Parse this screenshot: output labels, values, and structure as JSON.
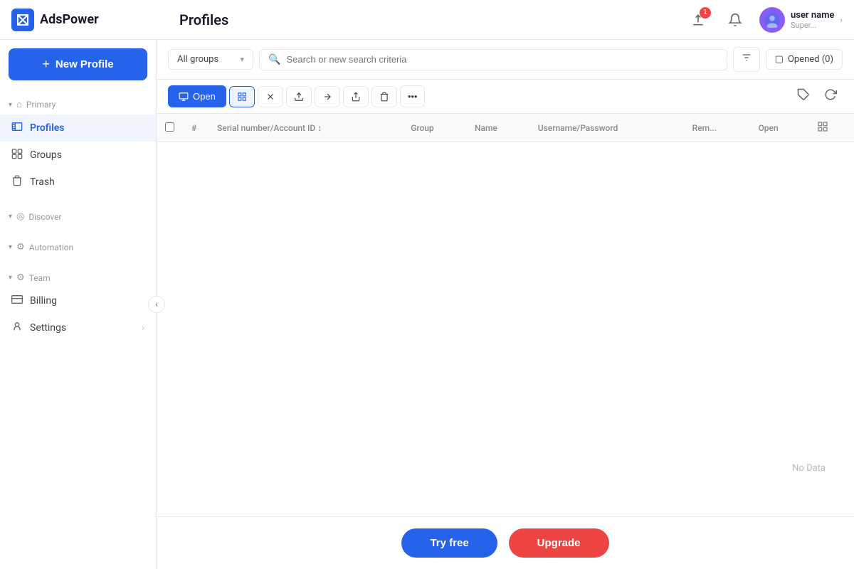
{
  "header": {
    "logo_text": "AdsPower",
    "logo_icon": "X",
    "title": "Profiles",
    "upload_badge": "1",
    "user_name": "user name",
    "user_role": "Super...",
    "chevron": "›"
  },
  "sidebar": {
    "new_profile_label": "New Profile",
    "plus_icon": "+",
    "sections": [
      {
        "name": "primary",
        "label": "Primary",
        "arrow": "▾",
        "items": [
          {
            "id": "profiles",
            "label": "Profiles",
            "icon": "📁",
            "active": true
          },
          {
            "id": "groups",
            "label": "Groups",
            "icon": "🗂"
          },
          {
            "id": "trash",
            "label": "Trash",
            "icon": "🗑"
          }
        ]
      },
      {
        "name": "discover",
        "label": "Discover",
        "arrow": "▾",
        "items": []
      },
      {
        "name": "automation",
        "label": "Automation",
        "arrow": "▾",
        "items": []
      },
      {
        "name": "team",
        "label": "Team",
        "arrow": "▾",
        "items": [
          {
            "id": "billing",
            "label": "Billing",
            "icon": "💳"
          },
          {
            "id": "settings",
            "label": "Settings",
            "icon": "👤",
            "chevron": "›"
          }
        ]
      }
    ],
    "toggle_icon": "‹"
  },
  "toolbar": {
    "groups_label": "All groups",
    "search_placeholder": "Search or new search criteria",
    "filter_icon": "⚙",
    "opened_icon": "▢",
    "opened_label": "Opened (0)"
  },
  "actions": {
    "open_label": "Open",
    "open_icon": "▢",
    "batch_icon": "⊞",
    "close_icon": "✕",
    "upload_icon": "↑",
    "move_icon": "→",
    "share_icon": "↗",
    "delete_icon": "🗑",
    "more_icon": "•••",
    "tag_icon": "🏷",
    "refresh_icon": "↺"
  },
  "table": {
    "columns": [
      {
        "id": "checkbox",
        "label": ""
      },
      {
        "id": "hash",
        "label": "#"
      },
      {
        "id": "serial",
        "label": "Serial number/Account ID ↕"
      },
      {
        "id": "group",
        "label": "Group"
      },
      {
        "id": "name",
        "label": "Name"
      },
      {
        "id": "username",
        "label": "Username/Password"
      },
      {
        "id": "remark",
        "label": "Rem..."
      },
      {
        "id": "open",
        "label": "Open"
      },
      {
        "id": "grid_icon",
        "label": "⊞"
      }
    ],
    "rows": [],
    "no_data_label": "No Data"
  },
  "bottom": {
    "try_free_label": "Try free",
    "upgrade_label": "Upgrade"
  }
}
